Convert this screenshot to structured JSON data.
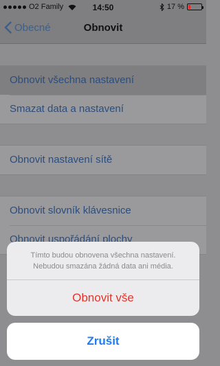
{
  "status_bar": {
    "carrier": "O2 Family",
    "time": "14:50",
    "battery": "17 %",
    "battery_level": 0.17,
    "battery_color": "#e0312b"
  },
  "nav": {
    "back_label": "Obecné",
    "title": "Obnovit"
  },
  "groups": [
    {
      "items": [
        "Obnovit všechna nastavení",
        "Smazat data a nastavení"
      ]
    },
    {
      "items": [
        "Obnovit nastavení sítě"
      ]
    },
    {
      "items": [
        "Obnovit slovník klávesnice",
        "Obnovit uspořádání plochy"
      ]
    }
  ],
  "action_sheet": {
    "message_line1": "Tímto budou obnovena všechna nastavení.",
    "message_line2": "Nebudou smazána žádná data ani média.",
    "destructive_label": "Obnovit vše",
    "cancel_label": "Zrušit"
  },
  "colors": {
    "link": "#2b4d7c",
    "destructive": "#e8332b",
    "cancel": "#1c7cf3"
  }
}
